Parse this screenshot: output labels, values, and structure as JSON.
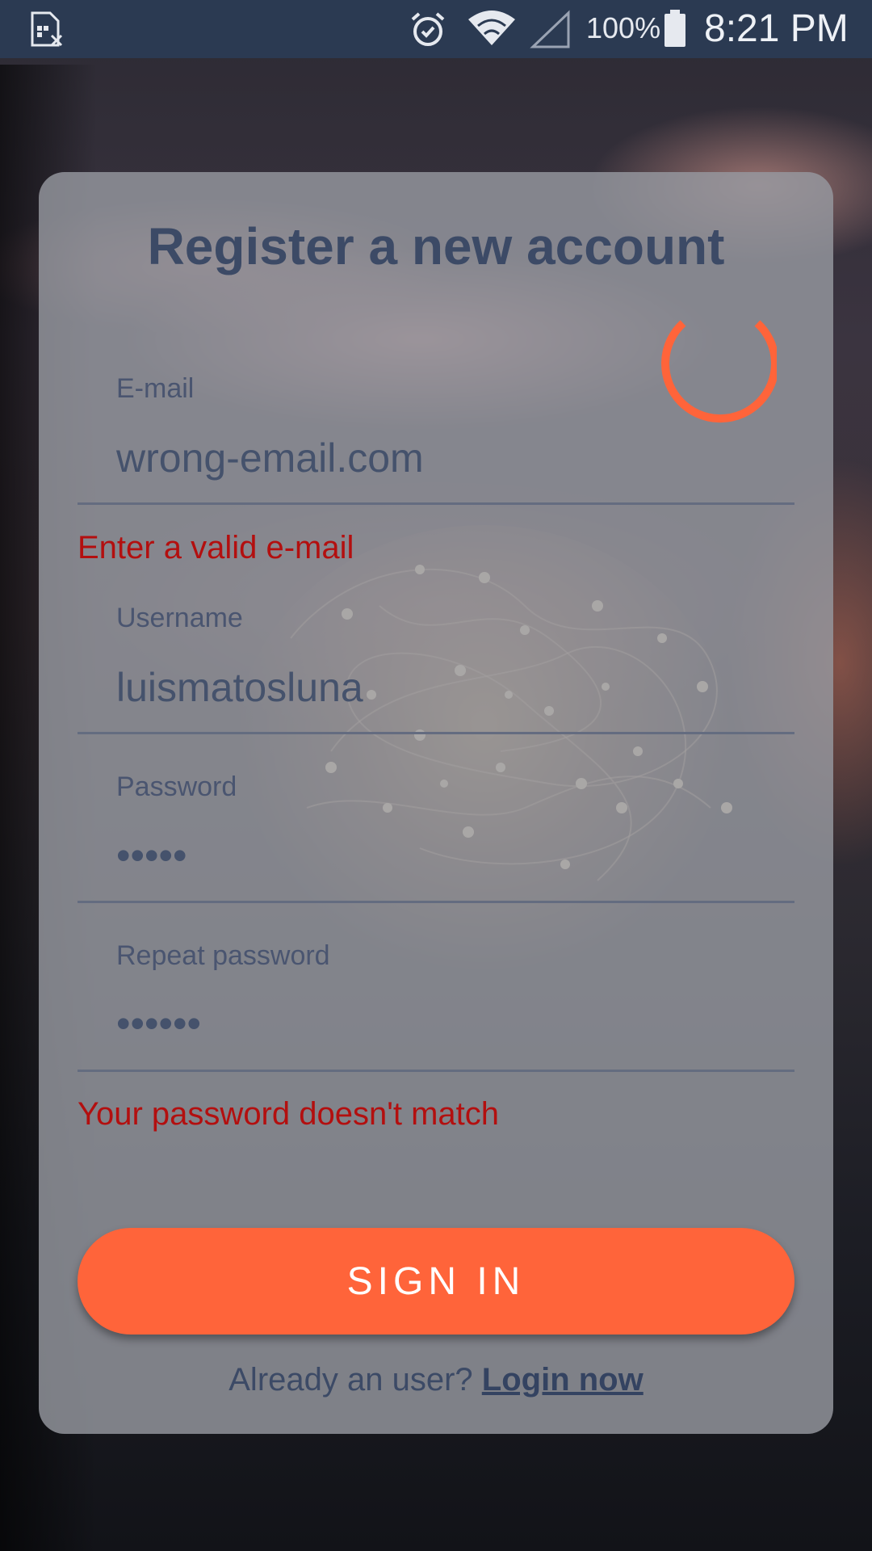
{
  "status_bar": {
    "left_icon": "sim-error-icon",
    "alarm_icon": "alarm-clock-icon",
    "wifi_icon": "wifi-icon",
    "signal_icon": "cell-signal-icon",
    "battery_text": "100%",
    "battery_icon": "battery-icon",
    "time": "8:21 PM"
  },
  "form": {
    "title": "Register a new account",
    "loading_spinner": "progress-spinner",
    "email": {
      "label": "E-mail",
      "value": "wrong-email.com",
      "error": "Enter a valid e-mail"
    },
    "username": {
      "label": "Username",
      "value": "luismatosluna"
    },
    "password": {
      "label": "Password",
      "value": "•••••"
    },
    "repeat_password": {
      "label": "Repeat password",
      "value": "••••••",
      "error": "Your password doesn't match"
    },
    "submit_label": "SIGN IN",
    "footer_text": "Already an user?",
    "footer_link": "Login now"
  },
  "colors": {
    "status_bar": "#2b3a52",
    "accent": "#ff643a",
    "error": "#b30f0f",
    "title": "#3c4a66"
  }
}
